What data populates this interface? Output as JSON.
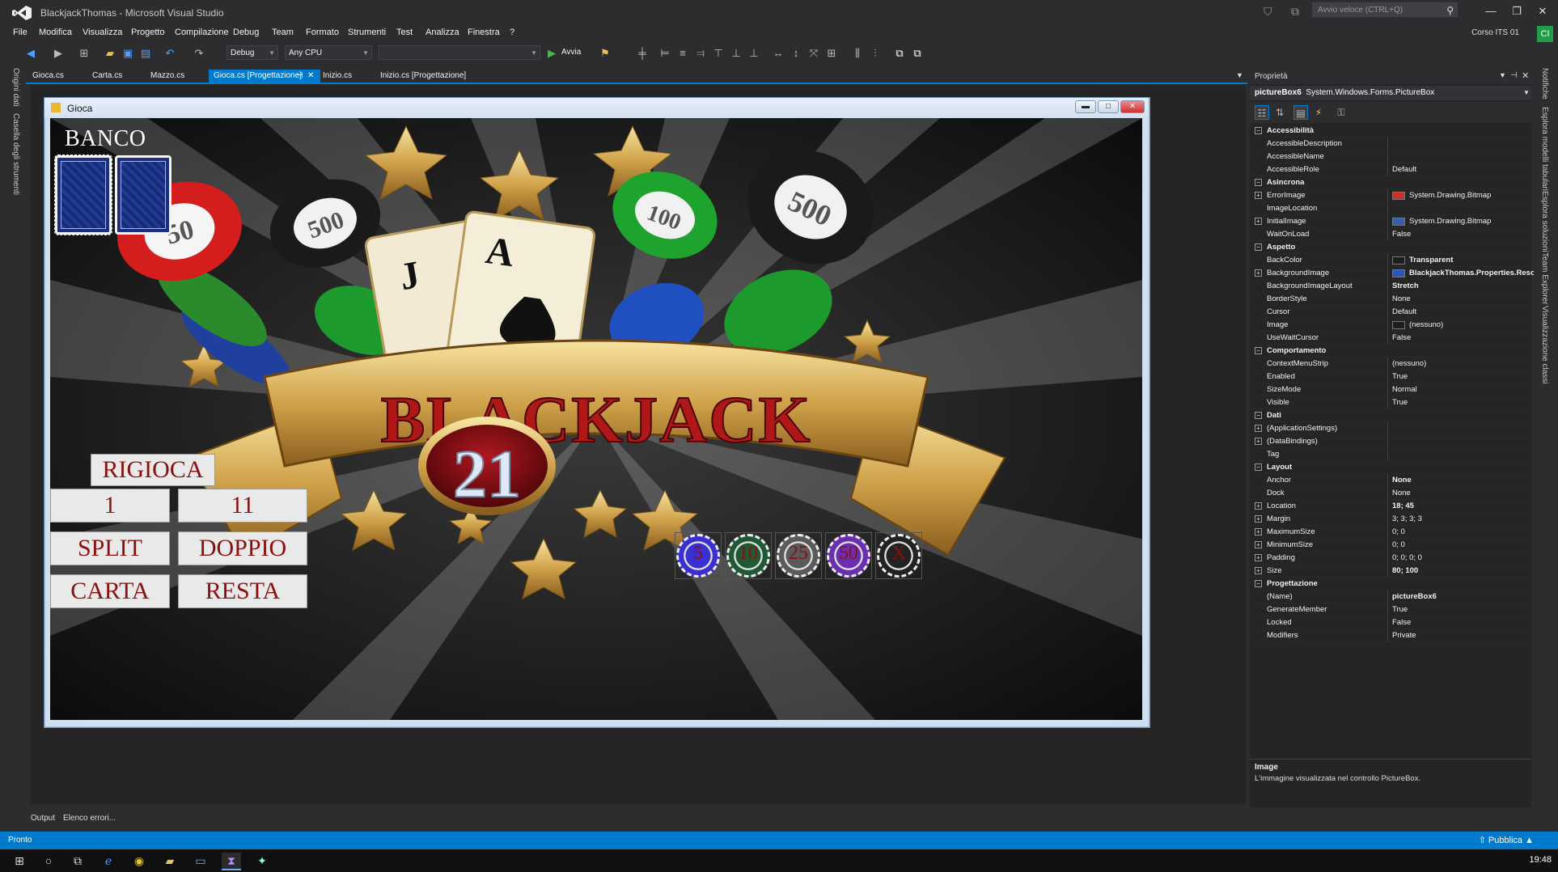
{
  "window": {
    "title": "BlackjackThomas - Microsoft Visual Studio",
    "quick_launch_placeholder": "Avvio veloce (CTRL+Q)",
    "minimize": "—",
    "maximize": "❐",
    "close": "✕"
  },
  "menu": [
    "File",
    "Modifica",
    "Visualizza",
    "Progetto",
    "Compilazione",
    "Debug",
    "Team",
    "Formato",
    "Strumenti",
    "Test",
    "Analizza",
    "Finestra",
    "?"
  ],
  "account": {
    "name": "Corso ITS 01",
    "initials": "CI"
  },
  "toolbar": {
    "config": "Debug",
    "platform": "Any CPU",
    "run_label": "Avvia"
  },
  "left_strip": [
    "Origini dati",
    "Casella degli strumenti"
  ],
  "right_strip": [
    "Notifiche",
    "Esplora modelli tabulari",
    "Esplora soluzioni",
    "Team Explorer",
    "Visualizzazione classi"
  ],
  "doc_tabs": [
    {
      "label": "Gioca.cs",
      "active": false
    },
    {
      "label": "Carta.cs",
      "active": false
    },
    {
      "label": "Mazzo.cs",
      "active": false
    },
    {
      "label": "Gioca.cs [Progettazione]",
      "active": true
    },
    {
      "label": "Inizio.cs",
      "active": false
    },
    {
      "label": "Inizio.cs [Progettazione]",
      "active": false
    }
  ],
  "active_tab_pin": "⊣",
  "active_tab_close": "✕",
  "form": {
    "title": "Gioca",
    "banco_label": "BANCO",
    "banner_text": "BLACKJACK",
    "banner_number": "21",
    "card_j": "J",
    "card_a": "A",
    "chip_labels": [
      "50",
      "500",
      "100",
      "500"
    ],
    "buttons": {
      "rigioca": "RIGIOCA",
      "one": "1",
      "eleven": "11",
      "split": "SPLIT",
      "doppio": "DOPPIO",
      "carta": "CARTA",
      "resta": "RESTA"
    },
    "bet_chips": [
      "5",
      "10",
      "25",
      "50",
      "X"
    ],
    "bet_chip_colors": [
      "#3a2fd0",
      "#1f5a35",
      "#5a5a5a",
      "#6a2fb0",
      "#222222"
    ]
  },
  "properties": {
    "header": "Proprietà",
    "object": "pictureBox6",
    "object_type": "System.Windows.Forms.PictureBox",
    "rows": [
      {
        "cat": true,
        "name": "Accessibilità"
      },
      {
        "name": "AccessibleDescription",
        "value": ""
      },
      {
        "name": "AccessibleName",
        "value": ""
      },
      {
        "name": "AccessibleRole",
        "value": "Default"
      },
      {
        "cat": true,
        "name": "Asincrona"
      },
      {
        "expand": true,
        "name": "ErrorImage",
        "value": "System.Drawing.Bitmap",
        "swatch": "#c9302c"
      },
      {
        "name": "ImageLocation",
        "value": ""
      },
      {
        "expand": true,
        "name": "InitialImage",
        "value": "System.Drawing.Bitmap",
        "swatch": "#3b5bb5"
      },
      {
        "name": "WaitOnLoad",
        "value": "False"
      },
      {
        "cat": true,
        "name": "Aspetto"
      },
      {
        "name": "BackColor",
        "value": "Transparent",
        "bold": true,
        "swatch": "#1e1e1e"
      },
      {
        "expand": true,
        "name": "BackgroundImage",
        "value": "BlackjackThomas.Properties.Resou",
        "bold": true,
        "swatch": "#2b56c0"
      },
      {
        "name": "BackgroundImageLayout",
        "value": "Stretch",
        "bold": true
      },
      {
        "name": "BorderStyle",
        "value": "None"
      },
      {
        "name": "Cursor",
        "value": "Default"
      },
      {
        "name": "Image",
        "value": "(nessuno)",
        "swatch": "#1e1e1e"
      },
      {
        "name": "UseWaitCursor",
        "value": "False"
      },
      {
        "cat": true,
        "name": "Comportamento"
      },
      {
        "name": "ContextMenuStrip",
        "value": "(nessuno)"
      },
      {
        "name": "Enabled",
        "value": "True"
      },
      {
        "name": "SizeMode",
        "value": "Normal"
      },
      {
        "name": "Visible",
        "value": "True"
      },
      {
        "cat": true,
        "name": "Dati"
      },
      {
        "expand": true,
        "name": "(ApplicationSettings)",
        "value": ""
      },
      {
        "expand": true,
        "name": "(DataBindings)",
        "value": ""
      },
      {
        "name": "Tag",
        "value": ""
      },
      {
        "cat": true,
        "name": "Layout"
      },
      {
        "name": "Anchor",
        "value": "None",
        "bold": true
      },
      {
        "name": "Dock",
        "value": "None"
      },
      {
        "expand": true,
        "name": "Location",
        "value": "18; 45",
        "bold": true
      },
      {
        "expand": true,
        "name": "Margin",
        "value": "3; 3; 3; 3"
      },
      {
        "expand": true,
        "name": "MaximumSize",
        "value": "0; 0"
      },
      {
        "expand": true,
        "name": "MinimumSize",
        "value": "0; 0"
      },
      {
        "expand": true,
        "name": "Padding",
        "value": "0; 0; 0; 0"
      },
      {
        "expand": true,
        "name": "Size",
        "value": "80; 100",
        "bold": true
      },
      {
        "cat": true,
        "name": "Progettazione"
      },
      {
        "name": "(Name)",
        "value": "pictureBox6",
        "bold": true
      },
      {
        "name": "GenerateMember",
        "value": "True"
      },
      {
        "name": "Locked",
        "value": "False"
      },
      {
        "name": "Modifiers",
        "value": "Private"
      }
    ],
    "desc_title": "Image",
    "desc_text": "L'immagine visualizzata nel controllo PictureBox."
  },
  "bottom_tabs": [
    "Output",
    "Elenco errori..."
  ],
  "status": {
    "text": "Pronto",
    "publish": "Pubblica"
  },
  "taskbar": {
    "clock": "19:48"
  }
}
